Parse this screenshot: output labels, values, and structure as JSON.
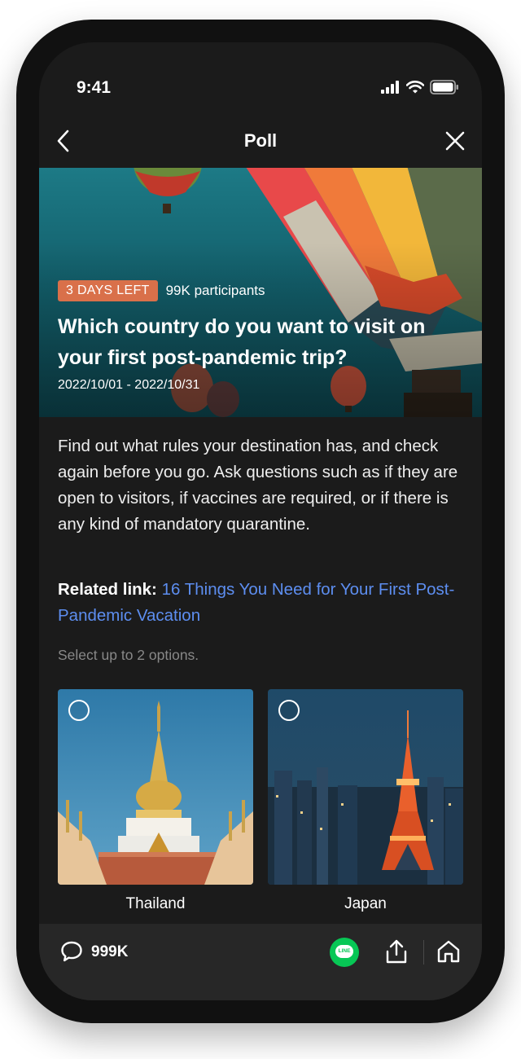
{
  "status_bar": {
    "time": "9:41",
    "icons": [
      "signal-icon",
      "wifi-icon",
      "battery-icon"
    ]
  },
  "nav": {
    "title": "Poll",
    "back_icon": "chevron-left-icon",
    "close_icon": "close-icon"
  },
  "hero": {
    "badge": "3 DAYS LEFT",
    "participants": "99K participants",
    "title": "Which country do you want to visit on your first post-pandemic trip?",
    "dates": "2022/10/01 - 2022/10/31"
  },
  "description": "Find out what rules your destination has, and check again before you go. Ask questions such as if they are open to visitors, if vaccines are required, or if there is any kind of mandatory quarantine.",
  "related": {
    "label": "Related link:",
    "link_text": "16 Things You Need for Your First Post-Pandemic Vacation"
  },
  "hint": "Select up to 2 options.",
  "options": [
    {
      "label": "Thailand"
    },
    {
      "label": "Japan"
    }
  ],
  "bottom_bar": {
    "comment_count": "999K",
    "line_label": "LINE"
  },
  "colors": {
    "badge": "#d9704a",
    "link": "#5d8ef0",
    "line_green": "#07c755",
    "background": "#1b1b1b"
  }
}
